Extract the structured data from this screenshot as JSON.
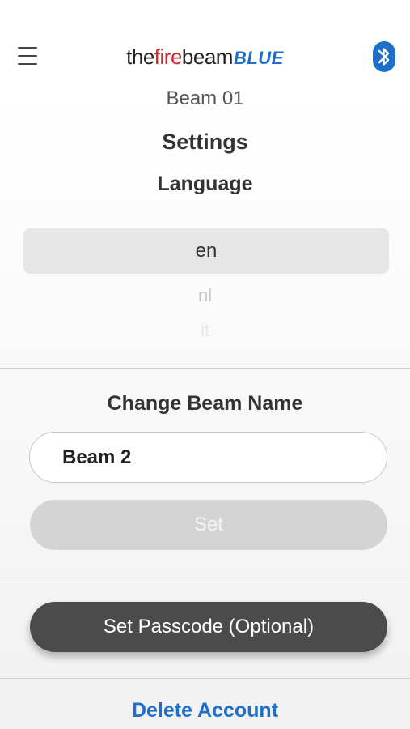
{
  "header": {
    "logo": {
      "the": "the",
      "fire": "fire",
      "beam": "beam",
      "blue": "BLUE"
    },
    "menu_icon": "hamburger-menu-icon",
    "bluetooth_icon": "bluetooth-icon",
    "brand_colors": {
      "fire_red": "#d8262d",
      "blue": "#1e6fc9"
    }
  },
  "device": {
    "name": "Beam 01"
  },
  "page": {
    "title": "Settings"
  },
  "language": {
    "title": "Language",
    "selected": "en",
    "options": [
      "nl",
      "it"
    ]
  },
  "rename": {
    "title": "Change Beam Name",
    "input_value": "Beam 2",
    "set_label": "Set"
  },
  "passcode": {
    "button_label": "Set Passcode (Optional)"
  },
  "account": {
    "delete_label": "Delete Account"
  }
}
